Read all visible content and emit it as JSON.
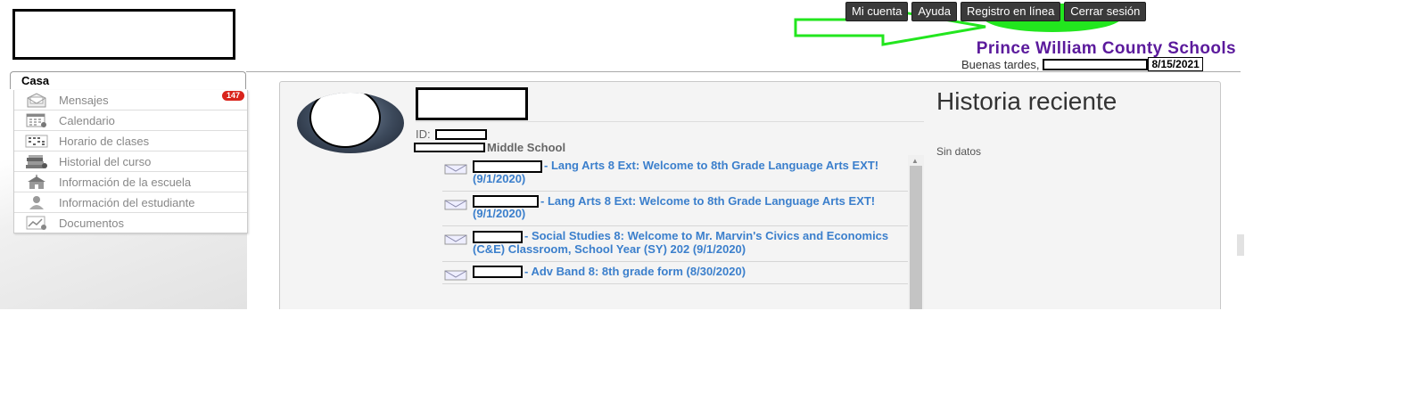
{
  "header": {
    "top_buttons": [
      {
        "label": "Mi cuenta"
      },
      {
        "label": "Ayuda"
      },
      {
        "label": "Registro en línea"
      },
      {
        "label": "Cerrar sesión"
      }
    ],
    "school_name": "Prince William County Schools",
    "greeting": "Buenas tardes,",
    "date": "8/15/2021",
    "highlight_color": "#22e61e"
  },
  "sidebar": {
    "home_tab": "Casa",
    "items": [
      {
        "label": "Mensajes",
        "icon": "envelope-icon",
        "badge": "147"
      },
      {
        "label": "Calendario",
        "icon": "calendar-icon"
      },
      {
        "label": "Horario de clases",
        "icon": "schedule-icon"
      },
      {
        "label": "Historial del curso",
        "icon": "books-icon"
      },
      {
        "label": "Información de la escuela",
        "icon": "school-icon"
      },
      {
        "label": "Información del estudiante",
        "icon": "person-icon"
      },
      {
        "label": "Documentos",
        "icon": "documents-icon"
      }
    ]
  },
  "student": {
    "id_label": "ID:",
    "school_suffix": "Middle School"
  },
  "messages": [
    {
      "text": "- Lang Arts 8 Ext: Welcome to 8th Grade Language Arts EXT! (9/1/2020)"
    },
    {
      "text": "- Lang Arts 8 Ext: Welcome to 8th Grade Language Arts EXT! (9/1/2020)"
    },
    {
      "text": "- Social Studies 8: Welcome to Mr. Marvin's Civics and Economics (C&E) Classroom, School Year (SY) 202 (9/1/2020)"
    },
    {
      "text": "- Adv Band 8: 8th grade form (8/30/2020)"
    }
  ],
  "history": {
    "title": "Historia reciente",
    "empty": "Sin datos"
  }
}
